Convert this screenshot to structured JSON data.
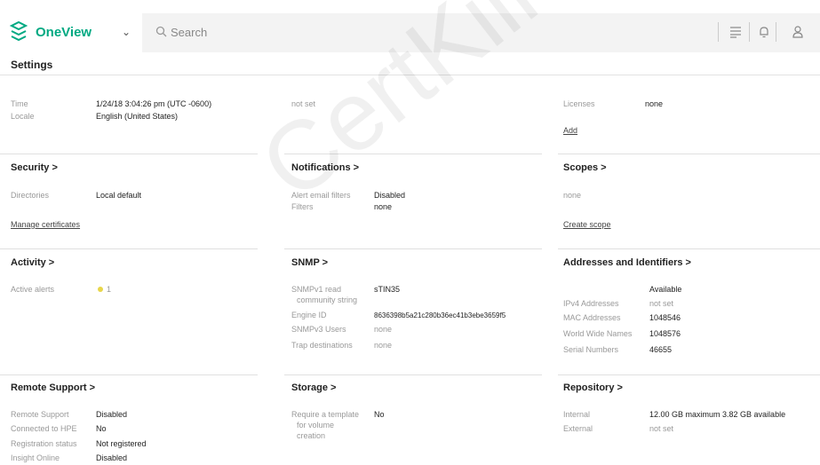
{
  "header": {
    "app_name": "OneView",
    "search_placeholder": "Search",
    "icons": [
      "hpe-logo-icon",
      "chevron-down-icon",
      "search-icon",
      "list-icon",
      "bell-icon",
      "user-icon"
    ]
  },
  "page": {
    "title": "Settings"
  },
  "general": {
    "time_label": "Time",
    "time_value": "1/24/18 3:04:26 pm (UTC -0600)",
    "locale_label": "Locale",
    "locale_value": "English (United States)",
    "middle_value": "not set",
    "licenses_label": "Licenses",
    "licenses_value": "none",
    "add_link": "Add"
  },
  "security": {
    "header": "Security >",
    "directories_label": "Directories",
    "directories_value": "Local default",
    "manage_link": "Manage certificates"
  },
  "notifications": {
    "header": "Notifications >",
    "alert_label": "Alert email filters",
    "alert_value": "Disabled",
    "filters_label": "Filters",
    "filters_value": "none"
  },
  "scopes": {
    "header": "Scopes >",
    "value": "none",
    "create_link": "Create scope"
  },
  "activity": {
    "header": "Activity >",
    "active_alerts_label": "Active alerts",
    "active_alerts_value": "1"
  },
  "snmp": {
    "header": "SNMP >",
    "read_label_1": "SNMPv1 read",
    "read_label_2": "community string",
    "read_value": "sTIN35",
    "engine_label": "Engine ID",
    "engine_value": "8636398b5a21c280b36ec41b3ebe3659f5",
    "users_label": "SNMPv3 Users",
    "users_value": "none",
    "trap_label": "Trap destinations",
    "trap_value": "none"
  },
  "addresses": {
    "header": "Addresses and Identifiers >",
    "available_header": "Available",
    "ipv4_label": "IPv4 Addresses",
    "ipv4_value": "not set",
    "mac_label": "MAC Addresses",
    "mac_value": "1048546",
    "wwn_label": "World Wide Names",
    "wwn_value": "1048576",
    "serial_label": "Serial Numbers",
    "serial_value": "46655"
  },
  "remote_support": {
    "header": "Remote Support >",
    "rs_label": "Remote Support",
    "rs_value": "Disabled",
    "hpe_label": "Connected to HPE",
    "hpe_value": "No",
    "reg_label": "Registration status",
    "reg_value": "Not registered",
    "insight_label": "Insight Online",
    "insight_value": "Disabled"
  },
  "storage": {
    "header": "Storage >",
    "template_label_1": "Require a template",
    "template_label_2": "for volume",
    "template_label_3": "creation",
    "template_value": "No"
  },
  "repository": {
    "header": "Repository >",
    "internal_label": "Internal",
    "internal_value": "12.00 GB maximum 3.82 GB available",
    "external_label": "External",
    "external_value": "not set"
  },
  "watermark": "CertKiller",
  "colors": {
    "brand": "#00a982",
    "alert": "#e8d64a"
  }
}
